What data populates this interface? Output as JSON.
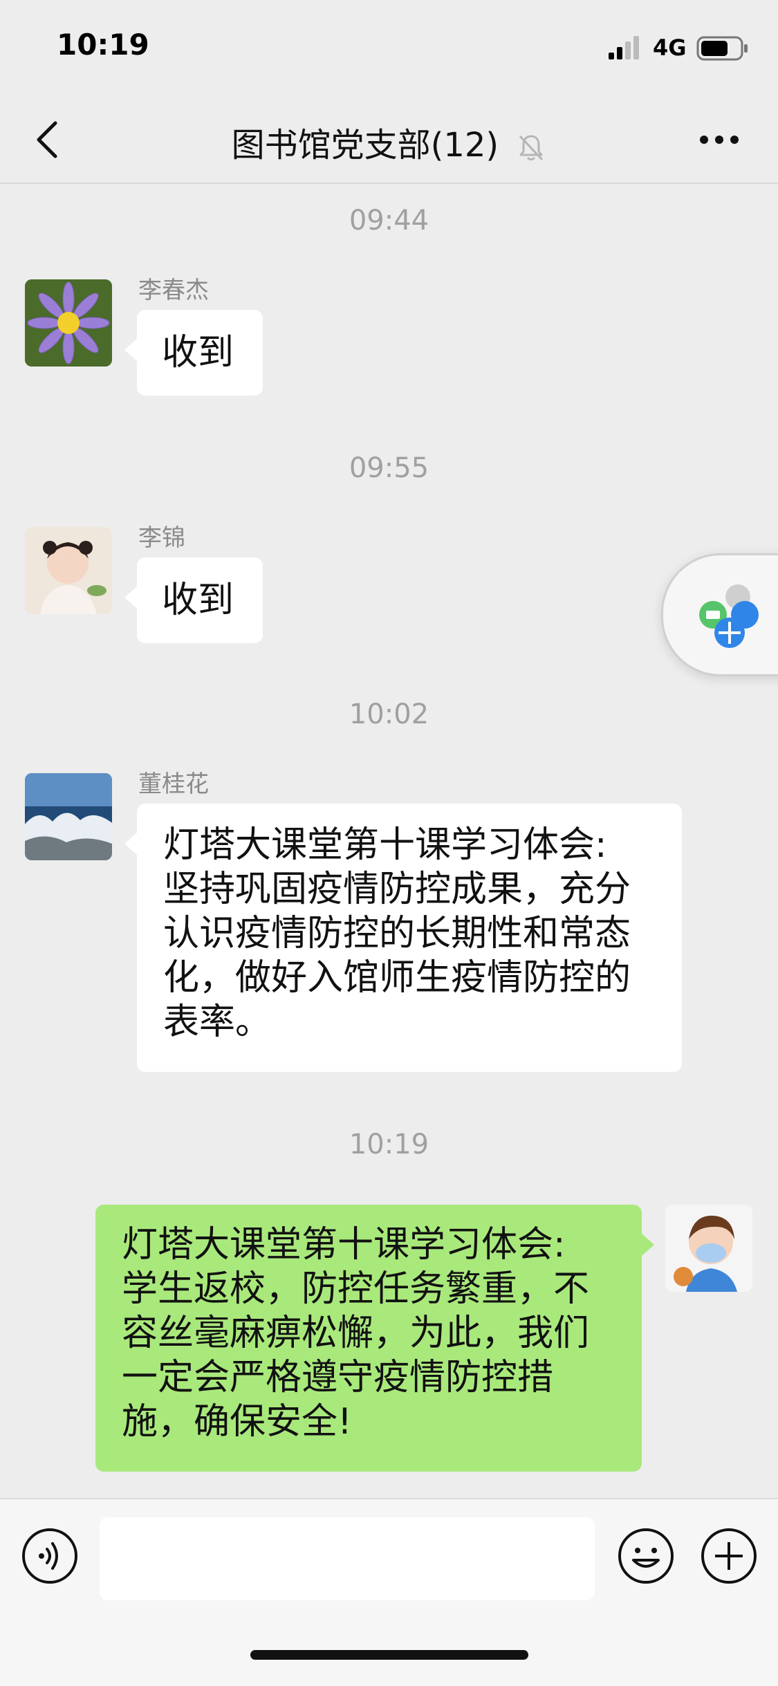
{
  "status_bar": {
    "time": "10:19",
    "network": "4G"
  },
  "nav": {
    "title": "图书馆党支部(12)"
  },
  "messages": [
    {
      "timestamp": "09:44",
      "sender": "李春杰",
      "text": "收到"
    },
    {
      "timestamp": "09:55",
      "sender": "李锦",
      "text": "收到"
    },
    {
      "timestamp": "10:02",
      "sender": "董桂花",
      "lines": [
        "灯塔大课堂第十课学习体会:",
        "坚持巩固疫情防控成果，充分",
        "认识疫情防控的长期性和常态",
        "化，做好入馆师生疫情防控的",
        "表率。"
      ]
    },
    {
      "timestamp": "10:19",
      "sender": "",
      "lines": [
        "灯塔大课堂第十课学习体会:",
        "学生返校，防控任务繁重，不",
        "容丝毫麻痹松懈，为此，我们",
        "一定会严格遵守疫情防控措",
        "施，确保安全!"
      ]
    }
  ],
  "colors": {
    "background": "#ededed",
    "my_bubble": "#a9e97c",
    "their_bubble": "#ffffff",
    "timestamp": "#a0a0a0"
  },
  "icons": [
    "signal-icon",
    "battery-icon",
    "back-icon",
    "mute-bell-icon",
    "more-icon",
    "voice-icon",
    "emoji-icon",
    "plus-icon",
    "floating-widget-icon"
  ]
}
